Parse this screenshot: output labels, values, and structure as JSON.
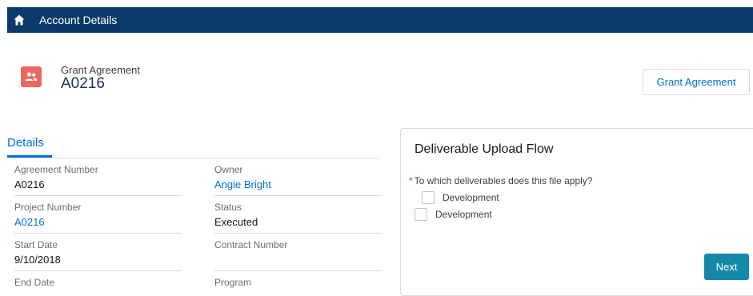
{
  "header": {
    "title": "Account Details",
    "home_icon": "home-icon",
    "color": "#0b3a6a"
  },
  "record": {
    "icon": "contact-people-icon",
    "icon_color": "#e8685f",
    "type": "Grant Agreement",
    "name": "A0216",
    "action_button": "Grant Agreement"
  },
  "details": {
    "tab_label": "Details",
    "fields": [
      {
        "label": "Agreement Number",
        "value": "A0216",
        "link": false
      },
      {
        "label": "Owner",
        "value": "Angie Bright",
        "link": true
      },
      {
        "label": "Project Number",
        "value": "A0216",
        "link": true
      },
      {
        "label": "Status",
        "value": "Executed",
        "link": false
      },
      {
        "label": "Start Date",
        "value": "9/10/2018",
        "link": false
      },
      {
        "label": "Contract Number",
        "value": "",
        "link": false
      },
      {
        "label": "End Date",
        "value": "",
        "link": false
      },
      {
        "label": "Program",
        "value": "",
        "link": false
      }
    ]
  },
  "flow": {
    "title": "Deliverable Upload Flow",
    "required_marker": "*",
    "question": "To which deliverables does this file apply?",
    "options": [
      {
        "label": "Development",
        "checked": false
      },
      {
        "label": "Development",
        "checked": false
      }
    ],
    "next_label": "Next"
  }
}
